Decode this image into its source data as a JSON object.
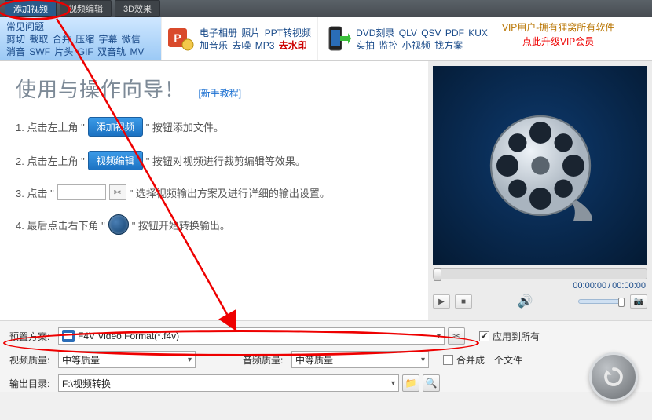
{
  "titlebar": {
    "add_video": "添加视频",
    "video_edit": "视频编辑",
    "effects_3d": "3D效果"
  },
  "linkbar": {
    "faq": "常见问题",
    "left_row1": [
      "剪切",
      "截取",
      "合并",
      "压缩",
      "字幕",
      "微信"
    ],
    "left_row2": [
      "消音",
      "SWF",
      "片头",
      "GIF",
      "双音轨",
      "MV"
    ],
    "block1_row1": [
      "电子相册",
      "照片",
      "PPT转视频"
    ],
    "block1_row2": [
      "加音乐",
      "去噪",
      "MP3"
    ],
    "block1_em": "去水印",
    "block2_row1": [
      "DVD刻录",
      "QLV",
      "QSV",
      "PDF",
      "KUX"
    ],
    "block2_row2": [
      "实拍",
      "监控",
      "小视频",
      "找方案"
    ],
    "vip_line1": "VIP用户-拥有狸窝所有软件",
    "vip_line2": "点此升级VIP会员"
  },
  "guide": {
    "title": "使用与操作向导！",
    "tutorial": "[新手教程]",
    "step1_pre": "1. 点击左上角 \"",
    "step1_btn": "添加视频",
    "step1_post": "\" 按钮添加文件。",
    "step2_pre": "2. 点击左上角 \"",
    "step2_btn": "视频编辑",
    "step2_post": "\" 按钮对视频进行裁剪编辑等效果。",
    "step3_pre": "3. 点击 \"",
    "step3_post": "\" 选择视频输出方案及进行详细的输出设置。",
    "step4_pre": "4. 最后点击右下角 \"",
    "step4_post": "\" 按钮开始转换输出。"
  },
  "preview": {
    "time_cur": "00:00:00",
    "time_sep": "/",
    "time_total": "00:00:00"
  },
  "bottom": {
    "preset_label": "预置方案:",
    "preset_value": "F4V Video Format(*.f4v)",
    "vq_label": "视频质量:",
    "vq_value": "中等质量",
    "aq_label": "音频质量:",
    "aq_value": "中等质量",
    "out_label": "输出目录:",
    "out_value": "F:\\视频转换",
    "apply_all": "应用到所有",
    "merge_one": "合并成一个文件"
  }
}
